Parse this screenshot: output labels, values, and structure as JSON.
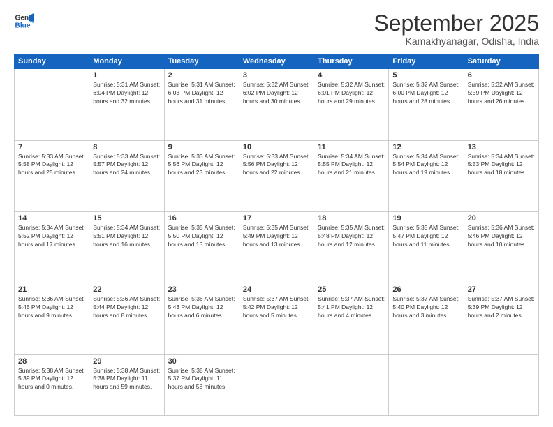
{
  "logo": {
    "line1": "General",
    "line2": "Blue"
  },
  "title": "September 2025",
  "location": "Kamakhyanagar, Odisha, India",
  "headers": [
    "Sunday",
    "Monday",
    "Tuesday",
    "Wednesday",
    "Thursday",
    "Friday",
    "Saturday"
  ],
  "weeks": [
    [
      {
        "day": "",
        "info": ""
      },
      {
        "day": "1",
        "info": "Sunrise: 5:31 AM\nSunset: 6:04 PM\nDaylight: 12 hours\nand 32 minutes."
      },
      {
        "day": "2",
        "info": "Sunrise: 5:31 AM\nSunset: 6:03 PM\nDaylight: 12 hours\nand 31 minutes."
      },
      {
        "day": "3",
        "info": "Sunrise: 5:32 AM\nSunset: 6:02 PM\nDaylight: 12 hours\nand 30 minutes."
      },
      {
        "day": "4",
        "info": "Sunrise: 5:32 AM\nSunset: 6:01 PM\nDaylight: 12 hours\nand 29 minutes."
      },
      {
        "day": "5",
        "info": "Sunrise: 5:32 AM\nSunset: 6:00 PM\nDaylight: 12 hours\nand 28 minutes."
      },
      {
        "day": "6",
        "info": "Sunrise: 5:32 AM\nSunset: 5:59 PM\nDaylight: 12 hours\nand 26 minutes."
      }
    ],
    [
      {
        "day": "7",
        "info": "Sunrise: 5:33 AM\nSunset: 5:58 PM\nDaylight: 12 hours\nand 25 minutes."
      },
      {
        "day": "8",
        "info": "Sunrise: 5:33 AM\nSunset: 5:57 PM\nDaylight: 12 hours\nand 24 minutes."
      },
      {
        "day": "9",
        "info": "Sunrise: 5:33 AM\nSunset: 5:56 PM\nDaylight: 12 hours\nand 23 minutes."
      },
      {
        "day": "10",
        "info": "Sunrise: 5:33 AM\nSunset: 5:56 PM\nDaylight: 12 hours\nand 22 minutes."
      },
      {
        "day": "11",
        "info": "Sunrise: 5:34 AM\nSunset: 5:55 PM\nDaylight: 12 hours\nand 21 minutes."
      },
      {
        "day": "12",
        "info": "Sunrise: 5:34 AM\nSunset: 5:54 PM\nDaylight: 12 hours\nand 19 minutes."
      },
      {
        "day": "13",
        "info": "Sunrise: 5:34 AM\nSunset: 5:53 PM\nDaylight: 12 hours\nand 18 minutes."
      }
    ],
    [
      {
        "day": "14",
        "info": "Sunrise: 5:34 AM\nSunset: 5:52 PM\nDaylight: 12 hours\nand 17 minutes."
      },
      {
        "day": "15",
        "info": "Sunrise: 5:34 AM\nSunset: 5:51 PM\nDaylight: 12 hours\nand 16 minutes."
      },
      {
        "day": "16",
        "info": "Sunrise: 5:35 AM\nSunset: 5:50 PM\nDaylight: 12 hours\nand 15 minutes."
      },
      {
        "day": "17",
        "info": "Sunrise: 5:35 AM\nSunset: 5:49 PM\nDaylight: 12 hours\nand 13 minutes."
      },
      {
        "day": "18",
        "info": "Sunrise: 5:35 AM\nSunset: 5:48 PM\nDaylight: 12 hours\nand 12 minutes."
      },
      {
        "day": "19",
        "info": "Sunrise: 5:35 AM\nSunset: 5:47 PM\nDaylight: 12 hours\nand 11 minutes."
      },
      {
        "day": "20",
        "info": "Sunrise: 5:36 AM\nSunset: 5:46 PM\nDaylight: 12 hours\nand 10 minutes."
      }
    ],
    [
      {
        "day": "21",
        "info": "Sunrise: 5:36 AM\nSunset: 5:45 PM\nDaylight: 12 hours\nand 9 minutes."
      },
      {
        "day": "22",
        "info": "Sunrise: 5:36 AM\nSunset: 5:44 PM\nDaylight: 12 hours\nand 8 minutes."
      },
      {
        "day": "23",
        "info": "Sunrise: 5:36 AM\nSunset: 5:43 PM\nDaylight: 12 hours\nand 6 minutes."
      },
      {
        "day": "24",
        "info": "Sunrise: 5:37 AM\nSunset: 5:42 PM\nDaylight: 12 hours\nand 5 minutes."
      },
      {
        "day": "25",
        "info": "Sunrise: 5:37 AM\nSunset: 5:41 PM\nDaylight: 12 hours\nand 4 minutes."
      },
      {
        "day": "26",
        "info": "Sunrise: 5:37 AM\nSunset: 5:40 PM\nDaylight: 12 hours\nand 3 minutes."
      },
      {
        "day": "27",
        "info": "Sunrise: 5:37 AM\nSunset: 5:39 PM\nDaylight: 12 hours\nand 2 minutes."
      }
    ],
    [
      {
        "day": "28",
        "info": "Sunrise: 5:38 AM\nSunset: 5:39 PM\nDaylight: 12 hours\nand 0 minutes."
      },
      {
        "day": "29",
        "info": "Sunrise: 5:38 AM\nSunset: 5:38 PM\nDaylight: 11 hours\nand 59 minutes."
      },
      {
        "day": "30",
        "info": "Sunrise: 5:38 AM\nSunset: 5:37 PM\nDaylight: 11 hours\nand 58 minutes."
      },
      {
        "day": "",
        "info": ""
      },
      {
        "day": "",
        "info": ""
      },
      {
        "day": "",
        "info": ""
      },
      {
        "day": "",
        "info": ""
      }
    ]
  ]
}
